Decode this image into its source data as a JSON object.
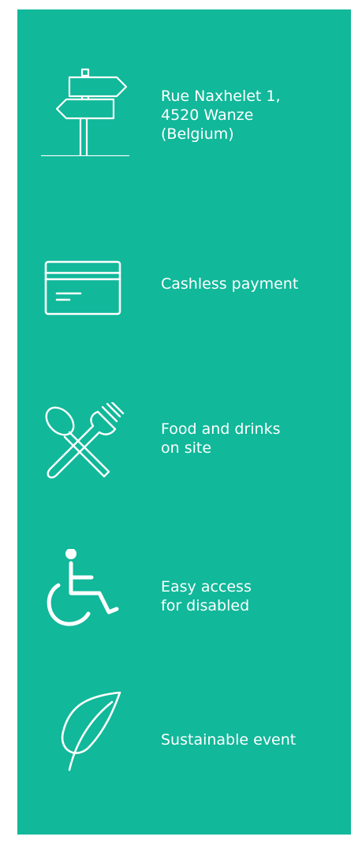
{
  "panel": {
    "background": "#11b89a",
    "foreground": "#ffffff"
  },
  "features": [
    {
      "icon": "signpost-icon",
      "label": "Rue Naxhelet 1,\n4520 Wanze\n(Belgium)"
    },
    {
      "icon": "credit-card-icon",
      "label": "Cashless payment"
    },
    {
      "icon": "fork-spoon-icon",
      "label": "Food and drinks\non site"
    },
    {
      "icon": "wheelchair-icon",
      "label": "Easy access\nfor disabled"
    },
    {
      "icon": "leaf-icon",
      "label": "Sustainable event"
    }
  ]
}
